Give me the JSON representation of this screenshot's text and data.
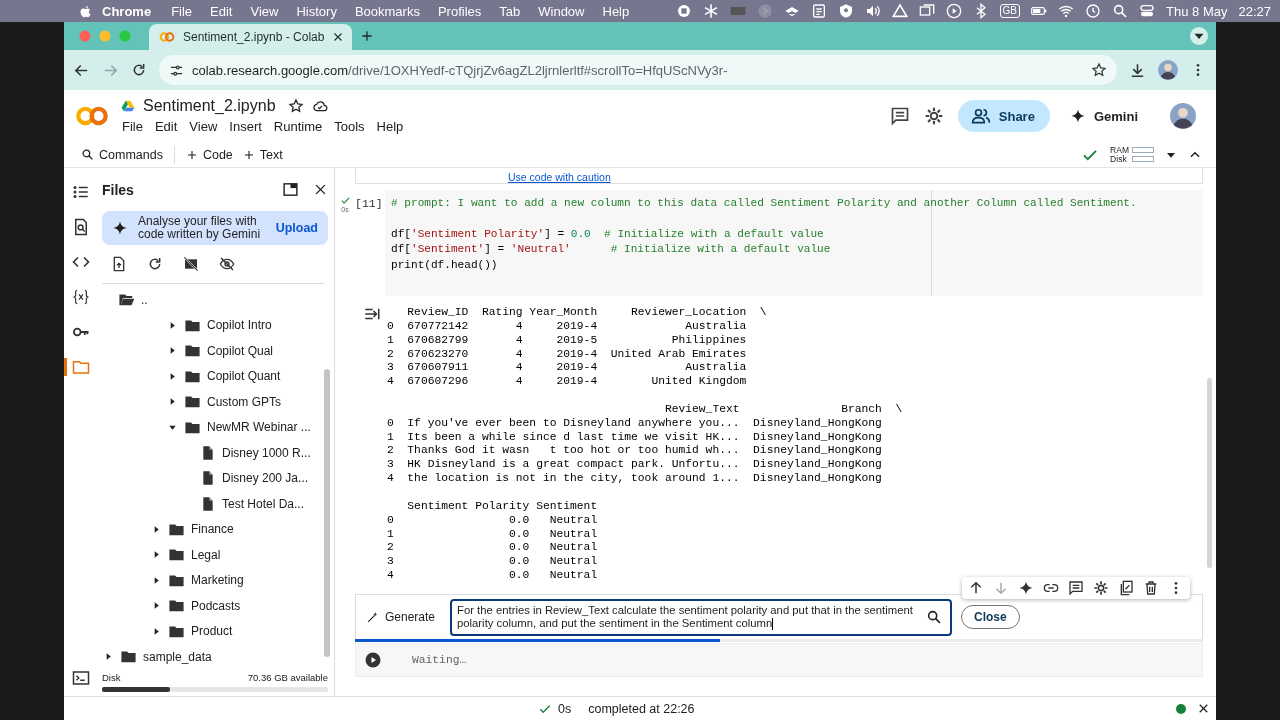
{
  "menubar": {
    "app": "Chrome",
    "menus": [
      "File",
      "Edit",
      "View",
      "History",
      "Bookmarks",
      "Profiles",
      "Tab",
      "Window",
      "Help"
    ],
    "input_source": "GB",
    "date": "Thu 8 May",
    "time": "22:27"
  },
  "browser": {
    "tabs": [
      {
        "title": "Sentiment_2.ipynb - Colab",
        "selected": true
      }
    ],
    "address": {
      "host": "colab.research.google.com",
      "path": "/drive/1OXHYedf-cTQjrjZv6agZL2ljrnlerltf#scrollTo=HfqUScNVy3r-"
    }
  },
  "notebook_header": {
    "title": "Sentiment_2.ipynb",
    "menus": [
      "File",
      "Edit",
      "View",
      "Insert",
      "Runtime",
      "Tools",
      "Help"
    ],
    "share": "Share",
    "gemini": "Gemini"
  },
  "toolbar": {
    "commands": "Commands",
    "add_code": "Code",
    "add_text": "Text",
    "ram": "RAM",
    "disk": "Disk"
  },
  "rail": {
    "items": [
      {
        "kind": "toc",
        "selected": false
      },
      {
        "kind": "find",
        "selected": false
      },
      {
        "kind": "snippets",
        "selected": false
      },
      {
        "kind": "variables",
        "selected": false
      },
      {
        "kind": "secrets",
        "selected": false
      },
      {
        "kind": "files",
        "selected": true
      },
      {
        "kind": "terminal",
        "selected": false
      }
    ]
  },
  "files": {
    "title": "Files",
    "banner": {
      "text": "Analyse your files with code written by Gemini",
      "action": "Upload"
    },
    "parent": "..",
    "tree": [
      {
        "children": [
          {
            "children": [
              {
                "name": "Copilot Intro",
                "kind": "folder",
                "expanded": false
              },
              {
                "name": "Copilot Qual",
                "kind": "folder",
                "expanded": false
              },
              {
                "name": "Copilot Quant",
                "kind": "folder",
                "expanded": false
              },
              {
                "name": "Custom GPTs",
                "kind": "folder",
                "expanded": false
              },
              {
                "name": "NewMR Webinar ...",
                "kind": "folder",
                "expanded": true,
                "children": [
                  {
                    "name": "Disney 1000 R...",
                    "kind": "file"
                  },
                  {
                    "name": "Disney 200 Ja...",
                    "kind": "file"
                  },
                  {
                    "name": "Test Hotel Da...",
                    "kind": "file"
                  }
                ]
              }
            ]
          },
          {
            "name": "Finance",
            "kind": "folder",
            "expanded": false
          },
          {
            "name": "Legal",
            "kind": "folder",
            "expanded": false
          },
          {
            "name": "Marketing",
            "kind": "folder",
            "expanded": false
          },
          {
            "name": "Podcasts",
            "kind": "folder",
            "expanded": false
          },
          {
            "name": "Product",
            "kind": "folder",
            "expanded": false
          }
        ]
      },
      {
        "name": "sample_data",
        "kind": "folder",
        "expanded": false
      }
    ],
    "disk": {
      "label": "Disk",
      "available": "70.36 GB available",
      "level": 0.3
    }
  },
  "notebook": {
    "prev_cell_link": "Use code with caution",
    "cell": {
      "exec_count": "[11]",
      "time": "0s",
      "lines": [
        {
          "gap_before": false,
          "segments": [
            {
              "kind": "comment",
              "text": "# prompt: I want to add a new column to this data called Sentiment Polarity and another Column called Sentiment."
            }
          ]
        },
        {
          "gap_before": true,
          "segments": [
            {
              "kind": "plain",
              "text": "df["
            },
            {
              "kind": "string",
              "text": "'Sentiment Polarity'"
            },
            {
              "kind": "plain",
              "text": "] = "
            },
            {
              "kind": "number",
              "text": "0.0"
            },
            {
              "kind": "comment",
              "text": "  # Initialize with a default value"
            }
          ]
        },
        {
          "gap_before": false,
          "segments": [
            {
              "kind": "plain",
              "text": "df["
            },
            {
              "kind": "string",
              "text": "'Sentiment'"
            },
            {
              "kind": "plain",
              "text": "] = "
            },
            {
              "kind": "string",
              "text": "'Neutral'"
            },
            {
              "kind": "comment",
              "text": "      # Initialize with a default value"
            }
          ]
        },
        {
          "gap_before": false,
          "segments": [
            {
              "kind": "plain",
              "text": "print(df.head())"
            }
          ]
        }
      ],
      "output": [
        [
          "   Review_ID  Rating Year_Month     Reviewer_Location  \\",
          "0  670772142       4     2019-4             Australia",
          "1  670682799       4     2019-5           Philippines",
          "2  670623270       4     2019-4  United Arab Emirates",
          "3  670607911       4     2019-4             Australia",
          "4  670607296       4     2019-4        United Kingdom"
        ],
        [
          "                                         Review_Text               Branch  \\",
          "0  If you've ever been to Disneyland anywhere you...  Disneyland_HongKong",
          "1  Its been a while since d last time we visit HK...  Disneyland_HongKong",
          "2  Thanks God it wasn   t too hot or too humid wh...  Disneyland_HongKong",
          "3  HK Disneyland is a great compact park. Unfortu...  Disneyland_HongKong",
          "4  the location is not in the city, took around 1...  Disneyland_HongKong"
        ],
        [
          "   Sentiment Polarity Sentiment",
          "0                 0.0   Neutral",
          "1                 0.0   Neutral",
          "2                 0.0   Neutral",
          "3                 0.0   Neutral",
          "4                 0.0   Neutral"
        ]
      ]
    },
    "generate": {
      "button": "Generate",
      "prompt": "For the entries in Review_Text calculate the sentiment polarity and put that in the sentiment polarity column, and put the sentiment in the Sentiment column",
      "close": "Close",
      "progress": {
        "level": 0.43
      }
    },
    "pending_cell": {
      "status": "Waiting…"
    }
  },
  "status_bar": {
    "duration": "0s",
    "message": "completed at 22:26"
  }
}
